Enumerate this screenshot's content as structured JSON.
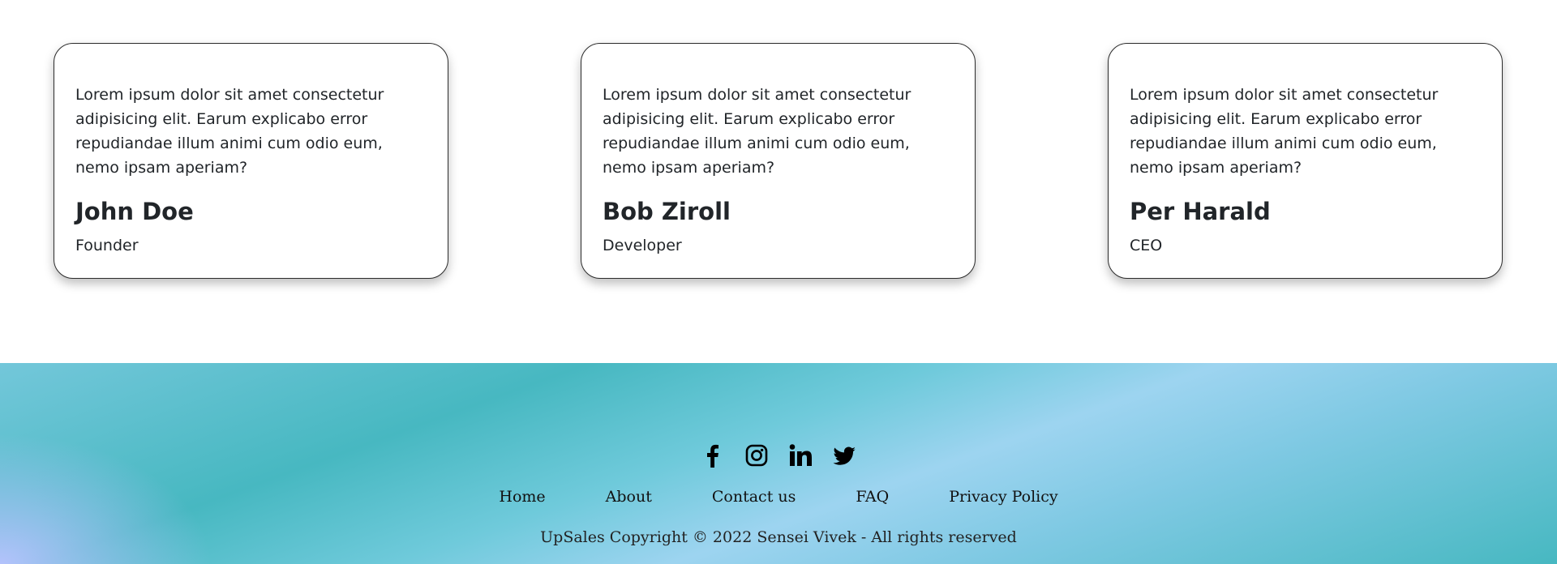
{
  "testimonials": [
    {
      "quote": "Lorem ipsum dolor sit amet consectetur adipisicing elit. Earum explicabo error repudiandae illum animi cum odio eum, nemo ipsam aperiam?",
      "name": "John Doe",
      "role": "Founder"
    },
    {
      "quote": "Lorem ipsum dolor sit amet consectetur adipisicing elit. Earum explicabo error repudiandae illum animi cum odio eum, nemo ipsam aperiam?",
      "name": "Bob Ziroll",
      "role": "Developer"
    },
    {
      "quote": "Lorem ipsum dolor sit amet consectetur adipisicing elit. Earum explicabo error repudiandae illum animi cum odio eum, nemo ipsam aperiam?",
      "name": "Per Harald",
      "role": "CEO"
    }
  ],
  "footer": {
    "socials": [
      "facebook-icon",
      "instagram-icon",
      "linkedin-icon",
      "twitter-icon"
    ],
    "links": [
      "Home",
      "About",
      "Contact us",
      "FAQ",
      "Privacy Policy"
    ],
    "copyright": "UpSales Copyright © 2022 Sensei Vivek - All rights reserved"
  },
  "colors": {
    "footer_teal": "#47b8c1",
    "footer_light_blue": "#9dd4f0",
    "footer_lavender": "#b9c3ff"
  }
}
